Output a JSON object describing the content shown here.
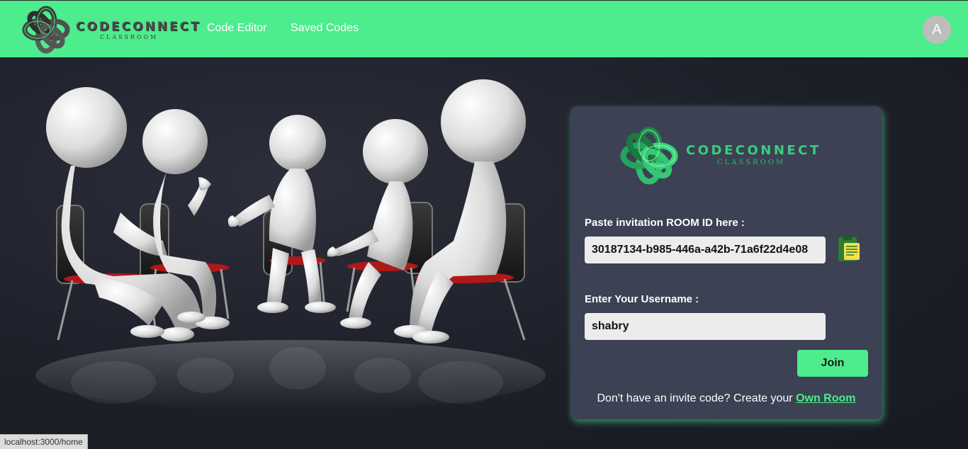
{
  "nav": {
    "logo_title": "CODECONNECT",
    "logo_subtitle": "CLASSROOM",
    "links": [
      "Code Editor",
      "Saved Codes"
    ],
    "avatar_initial": "A",
    "bg_color": "#4dec8c"
  },
  "card": {
    "logo_title": "CODECONNECT",
    "logo_subtitle": "CLASSROOM",
    "room_label": "Paste invitation ROOM ID here :",
    "room_value": "30187134-b985-446a-a42b-71a6f22d4e08",
    "username_label": "Enter Your Username :",
    "username_value": "shabry",
    "join_label": "Join",
    "footer_prefix": "Don't have an invite code? Create your ",
    "footer_link": "Own Room",
    "accent_color": "#4dec8c"
  },
  "icons": {
    "logo": "knot-logo-icon",
    "clipboard": "clipboard-paste-icon"
  },
  "status_bar": {
    "url": "localhost:3000/home"
  }
}
